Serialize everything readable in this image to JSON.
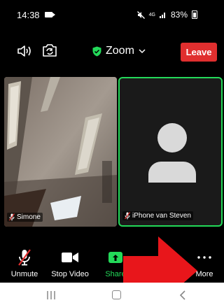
{
  "status_bar": {
    "time": "14:38",
    "network": "4G",
    "battery": "83%"
  },
  "top_bar": {
    "meeting_title": "Zoom",
    "leave_label": "Leave"
  },
  "participants": [
    {
      "name": "Simone",
      "muted": true,
      "video_on": true
    },
    {
      "name": "iPhone van Steven",
      "muted": true,
      "video_on": false,
      "active_speaker": true
    }
  ],
  "toolbar": {
    "unmute_label": "Unmute",
    "stop_video_label": "Stop Video",
    "share_label": "Share",
    "more_label": "More"
  },
  "colors": {
    "leave": "#e02f2f",
    "accent_green": "#23d959",
    "arrow": "#e8161b"
  }
}
